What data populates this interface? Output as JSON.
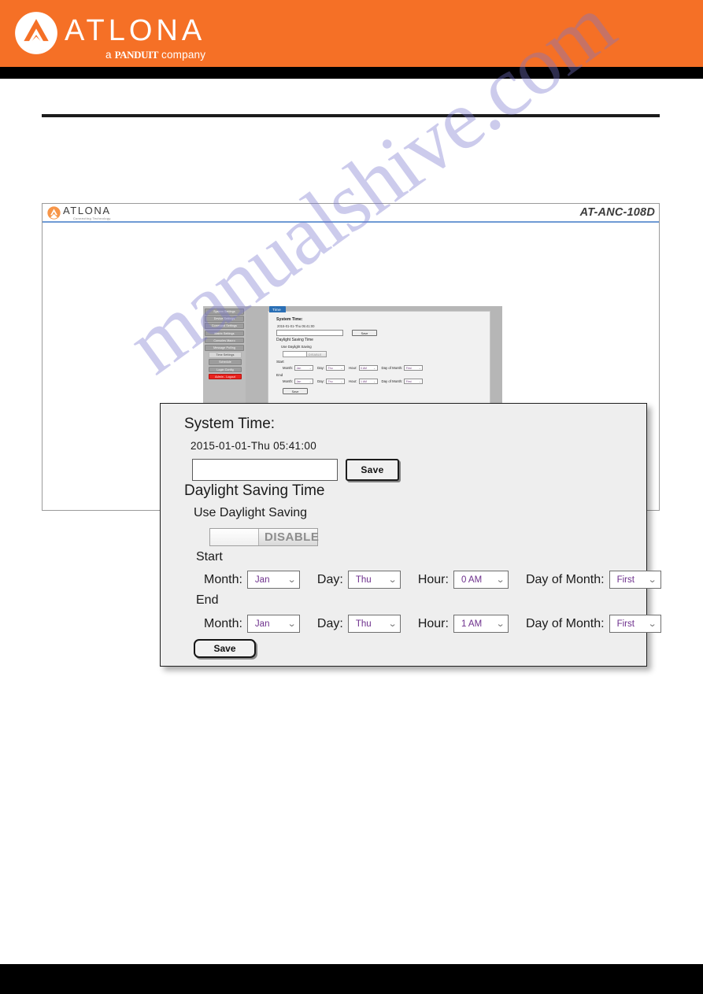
{
  "page": {
    "watermark": "manualshive.com"
  },
  "header": {
    "brand_wordmark": "ATLONA",
    "brand_tagline_prefix": "a ",
    "brand_tagline_brand": "PANDUIT",
    "brand_tagline_suffix": " company",
    "logo_icon": "atlona-mark-icon"
  },
  "screenshot": {
    "logo_word": "ATLONA",
    "logo_tagline": "Connecting Technology",
    "model": "AT-ANC-108D",
    "mini": {
      "tab_label": "Time",
      "menu_items": [
        {
          "label": "System Settings",
          "state": "normal"
        },
        {
          "label": "Device Settings",
          "state": "normal"
        },
        {
          "label": "Command Settings",
          "state": "normal"
        },
        {
          "label": "Matrix Settings",
          "state": "normal"
        },
        {
          "label": "Consoles Macro",
          "state": "normal"
        },
        {
          "label": "Message Polling",
          "state": "normal"
        },
        {
          "label": "Time Settings",
          "state": "active"
        },
        {
          "label": "Schedule",
          "state": "normal"
        },
        {
          "label": "Login Config",
          "state": "normal"
        },
        {
          "label": "Admin - Logout",
          "state": "logout"
        }
      ],
      "system_time_title": "System Time:",
      "system_time_value": "2015-01-01-Thu 05:41:00",
      "time_input_value": "",
      "save_top_label": "Save",
      "dst_title": "Daylight Saving Time",
      "use_dst_label": "Use Daylight Saving",
      "toggle_state": "DISABLE",
      "start_label": "Start",
      "end_label": "End",
      "month_label": "Month:",
      "day_label": "Day:",
      "hour_label": "Hour:",
      "dom_label": "Day of Month:",
      "start": {
        "month": "Jan",
        "day": "Thu",
        "hour": "0 AM",
        "day_of_month": "First"
      },
      "end": {
        "month": "Jan",
        "day": "Thu",
        "hour": "1 AM",
        "day_of_month": "First"
      },
      "save_bottom_label": "Save"
    }
  },
  "dialog": {
    "system_time_title": "System Time:",
    "system_time_value": "2015-01-01-Thu 05:41:00",
    "time_input_value": "",
    "time_input_placeholder": "",
    "save_top_label": "Save",
    "dst_title": "Daylight Saving Time",
    "use_dst_label": "Use Daylight Saving",
    "toggle_state": "DISABLE",
    "start_label": "Start",
    "end_label": "End",
    "labels": {
      "month": "Month:",
      "day": "Day:",
      "hour": "Hour:",
      "day_of_month": "Day of Month:"
    },
    "caret": "⌄",
    "start": {
      "month": "Jan",
      "day": "Thu",
      "hour": "0 AM",
      "day_of_month": "First"
    },
    "end": {
      "month": "Jan",
      "day": "Thu",
      "hour": "1 AM",
      "day_of_month": "First"
    },
    "save_bottom_label": "Save"
  },
  "colors": {
    "brand_orange": "#f57026",
    "accent_blue": "#6f9ad4",
    "logout_red": "#e8221d",
    "select_text": "#6d2f8c",
    "watermark": "#7876cd"
  }
}
